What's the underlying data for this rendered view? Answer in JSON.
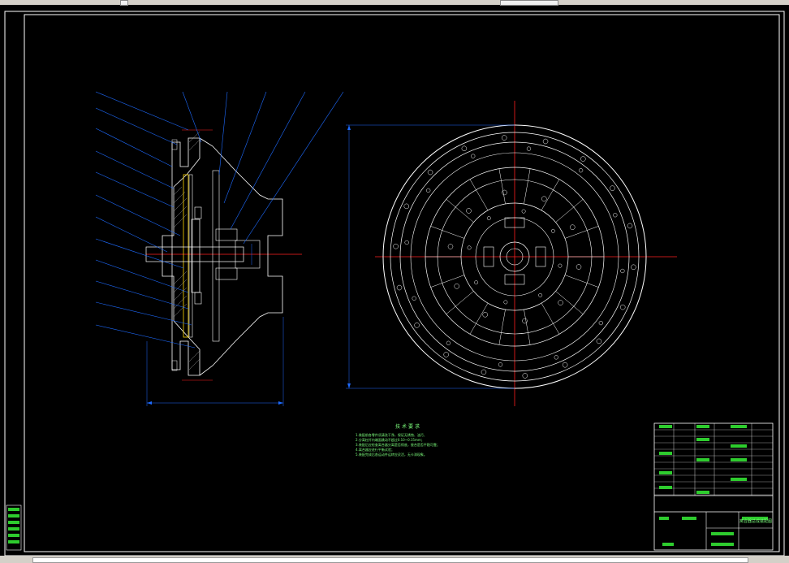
{
  "drawing": {
    "background": "#000000",
    "line_color": "#ffffff",
    "centerline_color": "#ff2020",
    "leader_color": "#1e6bff",
    "text_color": "#7dff7d",
    "title_block_fill": "#2ecc2e"
  },
  "technical_requirements": {
    "title": "技术要求",
    "lines": [
      "1.装配前各零件须清洗干净，保证无锈蚀、油污、",
      "2.分离杠杆内端面跳动不超过0.10~0.15mm；",
      "3.装配后应检查离合器分离是否彻底，接合是否平稳可靠；",
      "4.离合器应进行平衡试验；",
      "5.装配完成后各运动件运转应灵活，无卡滞现象。"
    ]
  },
  "title_block": {
    "name": "离合器总成装配图"
  }
}
